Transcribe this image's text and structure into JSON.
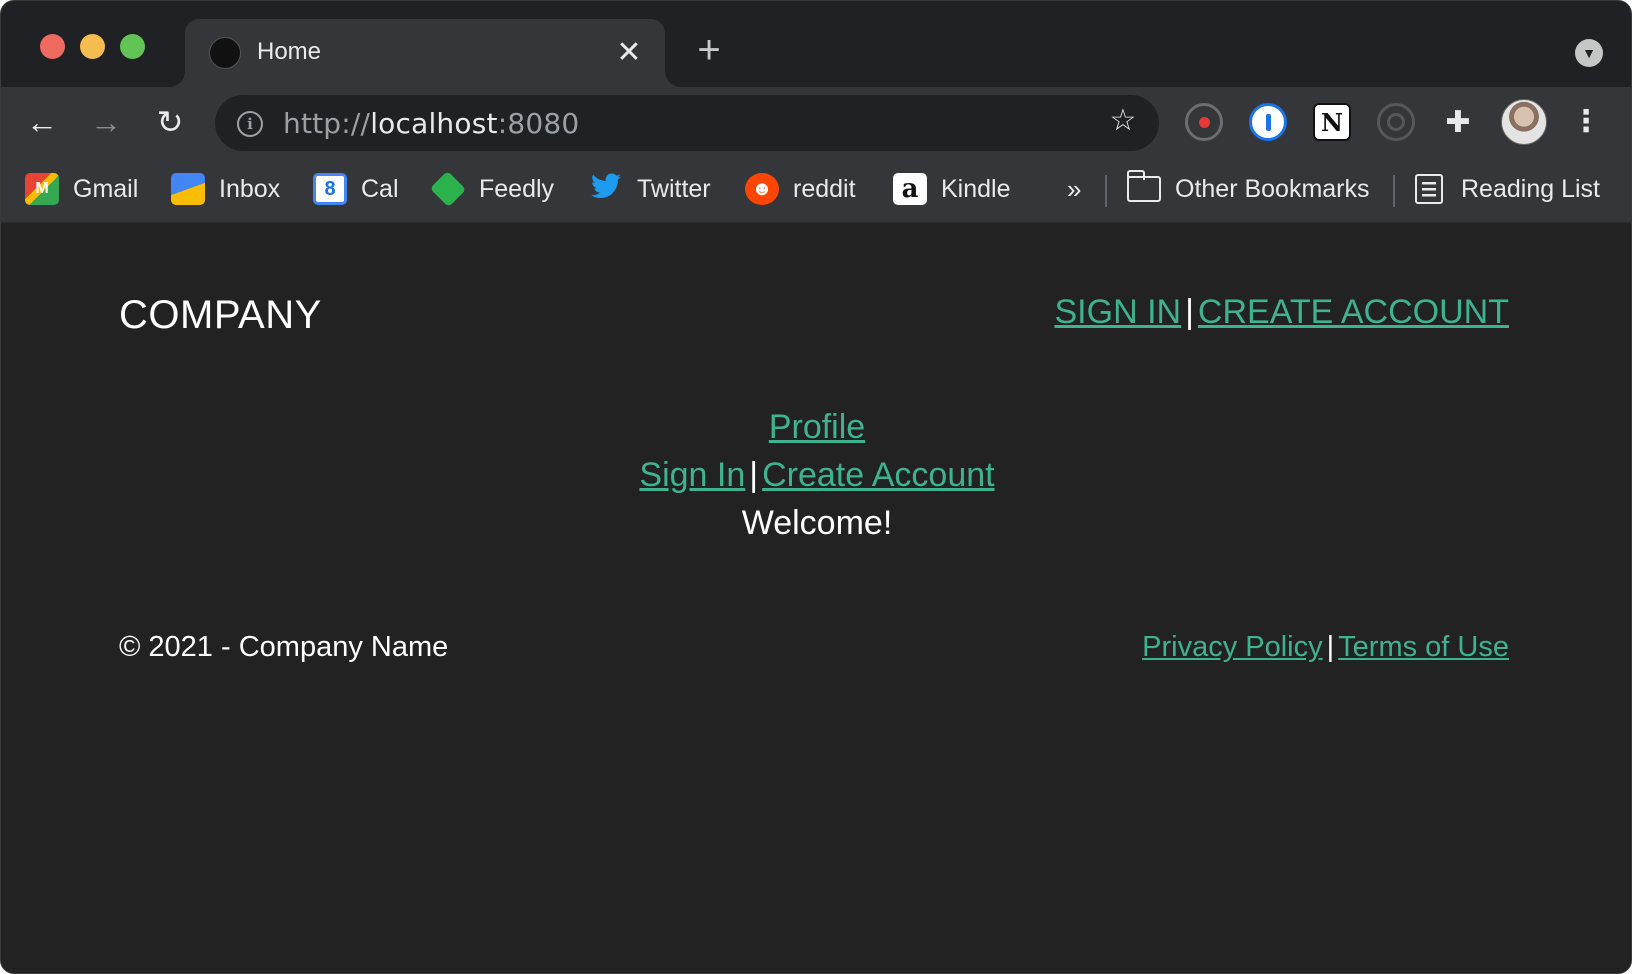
{
  "browser": {
    "tab": {
      "title": "Home",
      "close": "✕"
    },
    "new_tab": "+",
    "tab_search": "▼",
    "nav": {
      "back": "←",
      "forward": "→",
      "reload": "↻"
    },
    "address": {
      "scheme": "http://",
      "host": "localhost",
      "port": ":8080"
    },
    "star": "☆",
    "puzzle": "✚",
    "notion": "N",
    "menu": "⋮",
    "bookmarks": [
      {
        "label": "Gmail",
        "icon": "gmail-icon",
        "glyph": "M"
      },
      {
        "label": "Inbox",
        "icon": "inbox-icon",
        "glyph": ""
      },
      {
        "label": "Cal",
        "icon": "calendar-icon",
        "glyph": "8"
      },
      {
        "label": "Feedly",
        "icon": "feedly-icon",
        "glyph": ""
      },
      {
        "label": "Twitter",
        "icon": "twitter-icon",
        "glyph": "🐦"
      },
      {
        "label": "reddit",
        "icon": "reddit-icon",
        "glyph": "☻"
      },
      {
        "label": "Kindle",
        "icon": "kindle-icon",
        "glyph": "a"
      }
    ],
    "more": "»",
    "other_bookmarks": "Other Bookmarks",
    "reading_list": "Reading List"
  },
  "page": {
    "brand": "COMPANY",
    "header_links": {
      "sign_in": "SIGN IN",
      "separator": "|",
      "create_account": "CREATE ACCOUNT"
    },
    "profile_link": "Profile",
    "auth_links": {
      "sign_in": "Sign In",
      "separator": "|",
      "create_account": "Create Account"
    },
    "welcome": "Welcome!",
    "footer": {
      "copyright": "© 2021 - Company Name",
      "privacy": "Privacy Policy",
      "separator": "|",
      "terms": "Terms of Use"
    }
  },
  "colors": {
    "link": "#3fb28f",
    "page_bg": "#222222",
    "chrome": "#35363a"
  }
}
